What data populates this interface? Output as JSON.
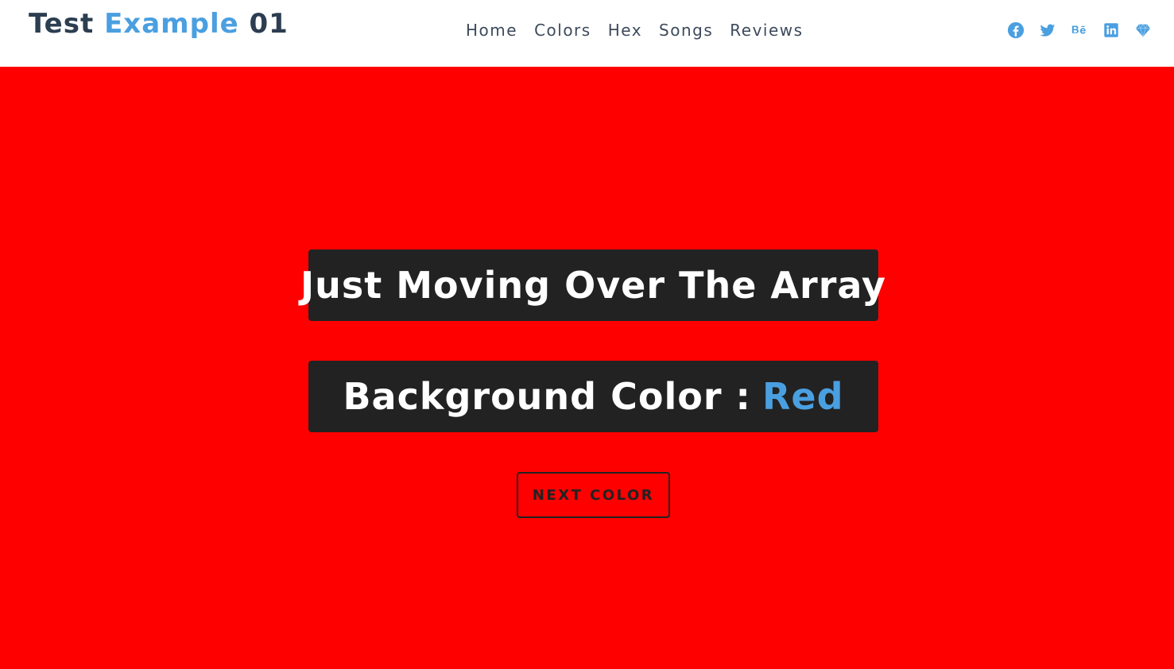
{
  "brand": {
    "part1": "Test",
    "part2": "Example",
    "part3": "01"
  },
  "nav": {
    "items": [
      {
        "label": "Home"
      },
      {
        "label": "Colors"
      },
      {
        "label": "Hex"
      },
      {
        "label": "Songs"
      },
      {
        "label": "Reviews"
      }
    ]
  },
  "social": {
    "icons": [
      "facebook-icon",
      "twitter-icon",
      "behance-icon",
      "linkedin-icon",
      "gem-icon"
    ],
    "color": "#4a9fe0"
  },
  "hero": {
    "background": "#ff0000",
    "heading": "Just Moving Over The Array",
    "bg_label": "Background Color :",
    "bg_value": "Red",
    "button_label": "NEXT COLOR"
  },
  "colors": {
    "accent": "#4a9fe0",
    "brand_dark": "#2c3e50",
    "panel": "#222222"
  }
}
